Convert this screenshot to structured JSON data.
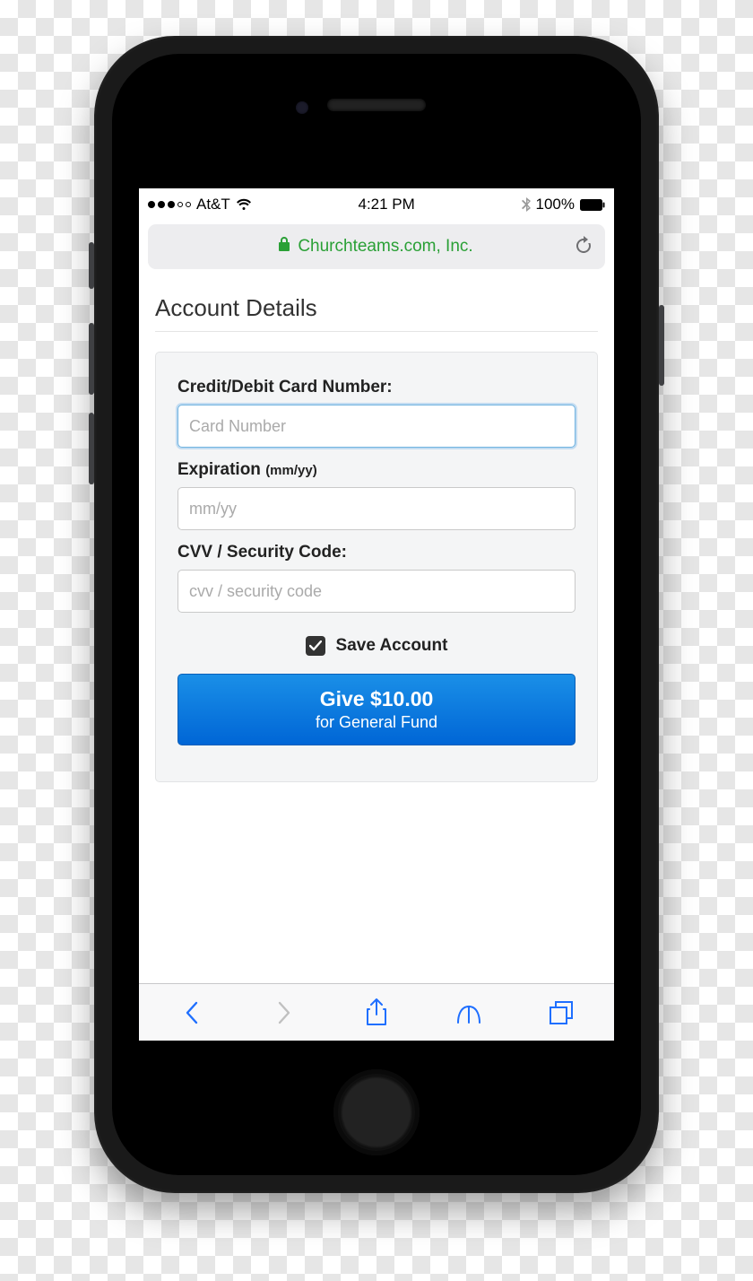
{
  "status_bar": {
    "carrier": "At&T",
    "time": "4:21 PM",
    "battery_percent": "100%"
  },
  "browser": {
    "site_title": "Churchteams.com, Inc."
  },
  "page": {
    "title": "Account Details"
  },
  "form": {
    "card_label": "Credit/Debit Card Number:",
    "card_placeholder": "Card Number",
    "expiry_label_main": "Expiration ",
    "expiry_label_hint": "(mm/yy)",
    "expiry_placeholder": "mm/yy",
    "cvv_label": "CVV / Security Code:",
    "cvv_placeholder": "cvv / security code",
    "save_label": "Save Account",
    "give_line1": "Give $10.00",
    "give_line2": "for General Fund"
  }
}
